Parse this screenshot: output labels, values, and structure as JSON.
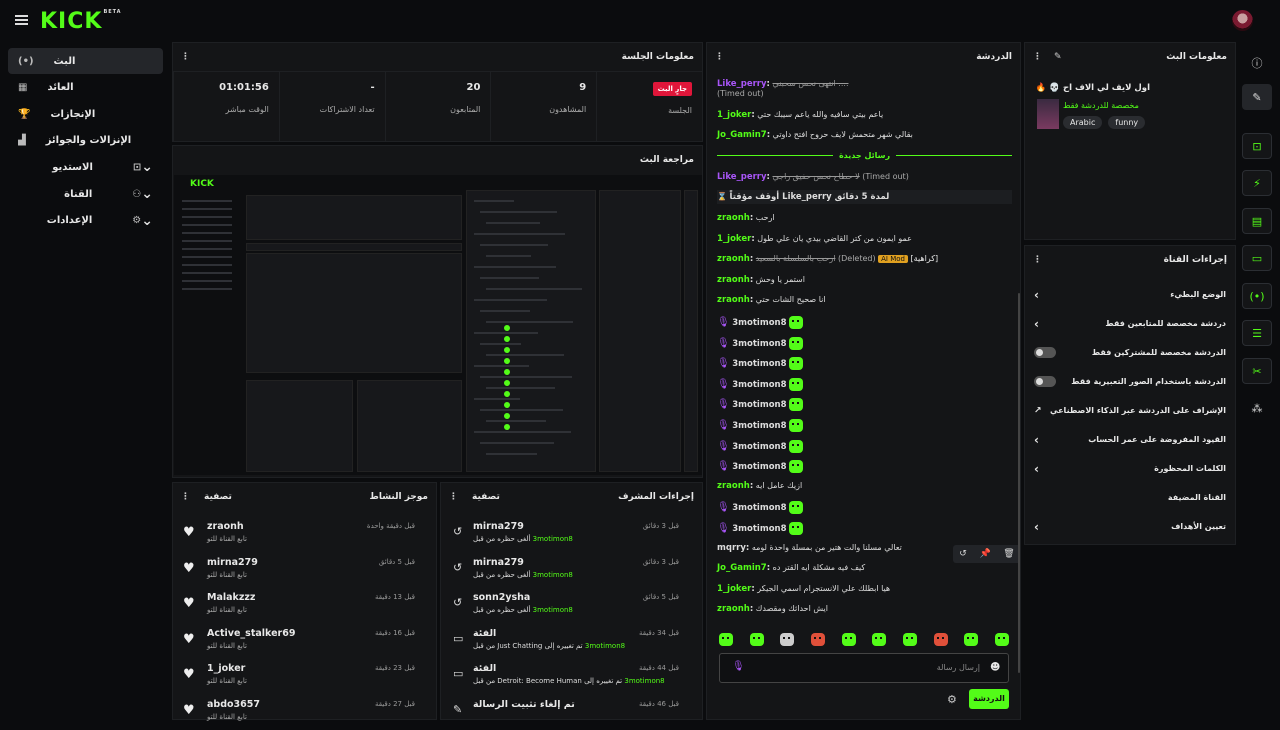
{
  "brand": "KICK",
  "brand_tag": "BETA",
  "nav": [
    {
      "label": "البث",
      "icon": "(•)",
      "name": "nav-stream"
    },
    {
      "label": "العائد",
      "icon": "▦",
      "name": "nav-revenue"
    },
    {
      "label": "الإنجازات",
      "icon": "🏆",
      "name": "nav-achievements"
    },
    {
      "label": "الإنزالات والجوائز",
      "icon": "▟",
      "name": "nav-drops"
    },
    {
      "label": "الاستديو",
      "icon": "⊡",
      "name": "nav-studio"
    },
    {
      "label": "القناة",
      "icon": "⚇",
      "name": "nav-channel"
    },
    {
      "label": "الإعدادات",
      "icon": "⚙",
      "name": "nav-settings"
    }
  ],
  "session": {
    "title": "معلومات الجلسة",
    "live_badge": "جارٍ البث",
    "stats": [
      {
        "value": "",
        "label": "الجلسة"
      },
      {
        "value": "9",
        "label": "المشاهدون"
      },
      {
        "value": "20",
        "label": "المتابعون"
      },
      {
        "value": "-",
        "label": "تعداد الاشتراكات"
      },
      {
        "value": "01:01:56",
        "label": "الوقت مباشر"
      }
    ]
  },
  "preview": {
    "title": "مراجعة البث"
  },
  "activity": {
    "title": "موجز النشاط",
    "filter": "تصفية",
    "items": [
      {
        "name": "zraonh",
        "sub": "تابع القناة للتو",
        "time": "قبل دقيقة واحدة"
      },
      {
        "name": "mirna279",
        "sub": "تابع القناة للتو",
        "time": "قبل 5 دقائق"
      },
      {
        "name": "Malakzzz",
        "sub": "تابع القناة للتو",
        "time": "قبل 13 دقيقة"
      },
      {
        "name": "Active_stalker69",
        "sub": "تابع القناة للتو",
        "time": "قبل 16 دقيقة"
      },
      {
        "name": "1_joker",
        "sub": "تابع القناة للتو",
        "time": "قبل 23 دقيقة"
      },
      {
        "name": "abdo3657",
        "sub": "تابع القناة للتو",
        "time": "قبل 27 دقيقة"
      }
    ]
  },
  "modactions": {
    "title": "إجراءات المشرف",
    "filter": "تصفية",
    "items": [
      {
        "name": "mirna279",
        "sub": "ألغى حظره من قبل",
        "by": "3motimon8",
        "time": "قبل 3 دقائق",
        "icon": "↺"
      },
      {
        "name": "mirna279",
        "sub": "ألغى حظره من قبل",
        "by": "3motimon8",
        "time": "قبل 3 دقائق",
        "icon": "↺"
      },
      {
        "name": "sonn2ysha",
        "sub": "ألغى حظره من قبل",
        "by": "3motimon8",
        "time": "قبل 5 دقائق",
        "icon": "↺"
      },
      {
        "name": "الفئة",
        "sub": "تم تغييره إلى Just Chatting من قبل",
        "by": "3motimon8",
        "time": "قبل 34 دقيقة",
        "icon": "▭"
      },
      {
        "name": "الفئة",
        "sub": "تم تغييره إلى Detroit: Become Human من قبل",
        "by": "3motimon8",
        "time": "قبل 44 دقيقة",
        "icon": "▭"
      },
      {
        "name": "تم إلغاء تثبيت الرسالة",
        "sub": "",
        "by": "",
        "time": "قبل 46 دقيقة",
        "icon": "✎"
      }
    ]
  },
  "chat": {
    "title": "الدردشة",
    "new_messages": "رسائل جديدة",
    "placeholder": "إرسال رسالة",
    "send": "الدردشة",
    "timed_out": "(Timed out)",
    "deleted": "(Deleted)",
    "ai_mod": "AI Mod",
    "mod_label": "[كراهية]",
    "lines": [
      {
        "user": "Like_perry",
        "text": "انتهى نحس سحبني ....",
        "kind": "timeout"
      },
      {
        "user": "1_joker",
        "text": "ياعم بيتي سافيه والله ياعم سيبك حتي"
      },
      {
        "user": "Jo_Gamin7",
        "text": "بقالي شهر متحمش لايف حروح افتح داوتي"
      },
      {
        "user": "Like_perry",
        "text": "لا حطاح نحس حفيق راجي",
        "kind": "timeout2"
      },
      {
        "user": "3motimon8",
        "text": "أوقف مؤقتاً Like_perry لمدة 5 دقائق",
        "kind": "sys"
      },
      {
        "user": "zraonh",
        "text": "ارحب"
      },
      {
        "user": "1_joker",
        "text": "عمو ايمون من كتر القاضي بيدي يان علي طول"
      },
      {
        "user": "zraonh",
        "text": "ارحب بالسلسلة بالسعيد",
        "kind": "deleted"
      },
      {
        "user": "zraonh",
        "text": "استمر يا وحش"
      },
      {
        "user": "zraonh",
        "text": "انا صحيح الشات حتي"
      },
      {
        "user": "3motimon8",
        "kind": "emote"
      },
      {
        "user": "3motimon8",
        "kind": "emote"
      },
      {
        "user": "3motimon8",
        "kind": "emote"
      },
      {
        "user": "3motimon8",
        "kind": "emote"
      },
      {
        "user": "3motimon8",
        "kind": "emote"
      },
      {
        "user": "3motimon8",
        "kind": "emote"
      },
      {
        "user": "3motimon8",
        "kind": "emote"
      },
      {
        "user": "3motimon8",
        "kind": "emote"
      },
      {
        "user": "zraonh",
        "text": "ازيك عامل ايه"
      },
      {
        "user": "3motimon8",
        "kind": "emote"
      },
      {
        "user": "3motimon8",
        "kind": "emote"
      },
      {
        "user": "mqrry",
        "text": "تعالي مسلنا والت هتير من بمسلة واحدة لومه"
      },
      {
        "user": "Jo_Gamin7",
        "text": "كيف فيه مشكلة ايه القتر ده"
      },
      {
        "user": "1_joker",
        "text": "هيا ابطلك علي الانستجرام اسمي الجيكر"
      },
      {
        "user": "zraonh",
        "text": "ايش احداثك ومقصدك"
      }
    ]
  },
  "streaminfo": {
    "title": "معلومات البث",
    "stream_title": "اول لايف لي الاف اح",
    "category": "مخصصة للدردشة فقط",
    "tags": [
      "Arabic",
      "funny"
    ]
  },
  "channel_actions": {
    "title": "إجراءات القناة",
    "rows": [
      {
        "label": "الوضع البطيء",
        "ctrl": "chev"
      },
      {
        "label": "دردشة مخصصة للمتابعين فقط",
        "ctrl": "chev"
      },
      {
        "label": "الدردشة مخصصة للمشتركين فقط",
        "ctrl": "toggle"
      },
      {
        "label": "الدردشة باستخدام الصور التعبيرية فقط",
        "ctrl": "toggle"
      },
      {
        "label": "الإشراف على الدردشة عبر الذكاء الاصطناعي",
        "ctrl": "ext"
      },
      {
        "label": "القيود المفروضة على عمر الحساب",
        "ctrl": "chev"
      },
      {
        "label": "الكلمات المحظورة",
        "ctrl": "chev"
      },
      {
        "label": "القناة المضيفة",
        "ctrl": "none"
      },
      {
        "label": "تعيين الأهداف",
        "ctrl": "chev"
      }
    ]
  },
  "rightbar": [
    "info-icon",
    "pencil-icon",
    "screenshot-icon",
    "lightning-icon",
    "clipboard-icon",
    "chat-icon",
    "broadcast-icon",
    "layout-icon",
    "wrench-icon",
    "share-icon"
  ]
}
